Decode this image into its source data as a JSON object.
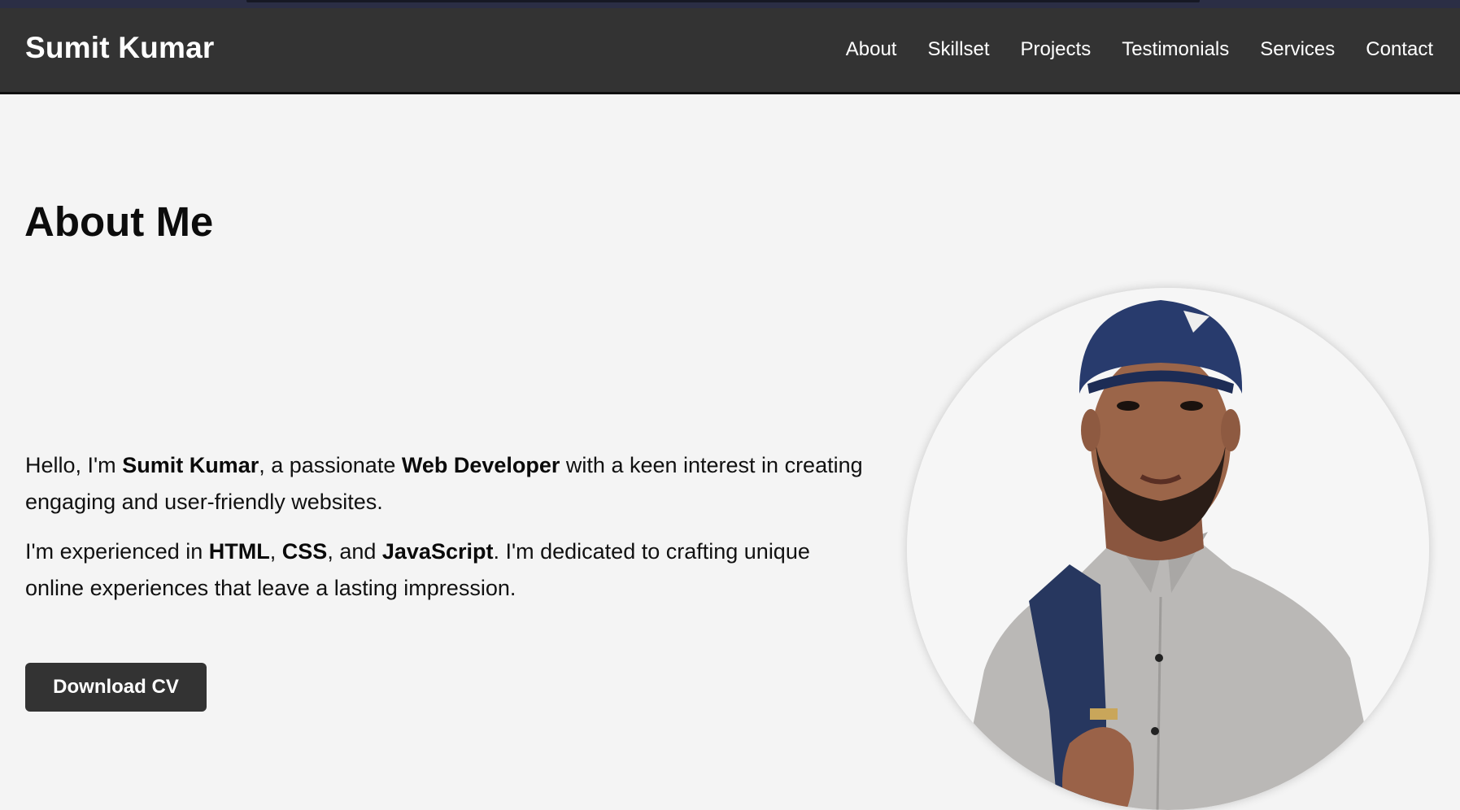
{
  "header": {
    "brand": "Sumit Kumar",
    "nav": [
      "About",
      "Skillset",
      "Projects",
      "Testimonials",
      "Services",
      "Contact"
    ]
  },
  "about": {
    "title": "About Me",
    "p1": {
      "t1": "Hello, I'm ",
      "b1": "Sumit Kumar",
      "t2": ", a passionate ",
      "b2": "Web Developer",
      "t3": " with a keen interest in creating engaging and user-friendly websites."
    },
    "p2": {
      "t1": "I'm experienced in ",
      "b1": "HTML",
      "t2": ", ",
      "b2": "CSS",
      "t3": ", and ",
      "b3": "JavaScript",
      "t4": ". I'm dedicated to crafting unique online experiences that leave a lasting impression."
    },
    "button_label": "Download CV"
  },
  "colors": {
    "header_bg": "#333333",
    "page_bg": "#f4f4f4",
    "button_bg": "#333333"
  }
}
